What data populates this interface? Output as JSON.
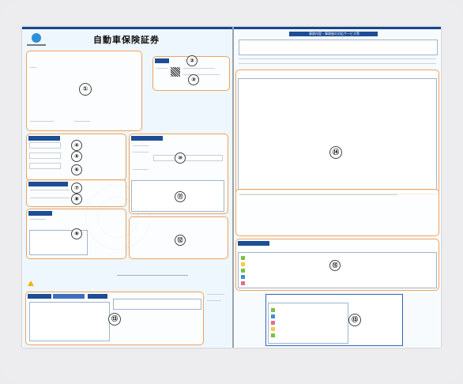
{
  "document": {
    "title": "自動車保険証券",
    "right_title": "事故内容・事故後の対応サービス等"
  },
  "markers": [
    "①",
    "②",
    "③",
    "④",
    "⑤",
    "⑥",
    "⑦",
    "⑧",
    "⑨",
    "⑩",
    "⑪",
    "⑫",
    "⑬",
    "⑭",
    "⑮",
    "⑬"
  ],
  "colors": {
    "accent_orange": "#f0a25c",
    "header_navy": "#1d4d96",
    "sheet_blue": "#eef7fd"
  }
}
